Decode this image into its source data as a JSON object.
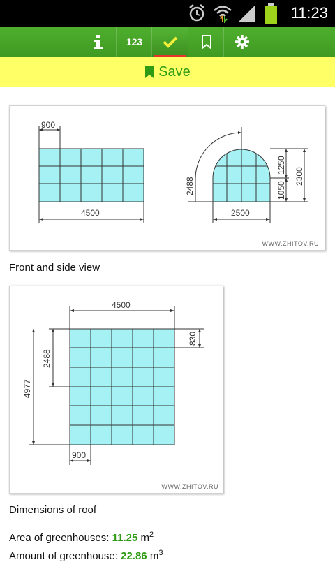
{
  "status_bar": {
    "time": "11:23",
    "icons": [
      "alarm-icon",
      "wifi-icon",
      "signal-icon",
      "battery-icon"
    ]
  },
  "toolbar": {
    "items": [
      {
        "name": "info",
        "icon": "info-icon"
      },
      {
        "name": "numbers",
        "label": "123"
      },
      {
        "name": "check",
        "icon": "check-icon",
        "active": true
      },
      {
        "name": "bookmark",
        "icon": "bookmark-icon"
      },
      {
        "name": "settings",
        "icon": "gear-icon"
      }
    ]
  },
  "save_bar": {
    "label": "Save",
    "icon": "bookmark-icon"
  },
  "diagram1": {
    "dim_900": "900",
    "dim_4500": "4500",
    "dim_2488": "2488",
    "dim_2500": "2500",
    "dim_1250": "1250",
    "dim_1050": "1050",
    "dim_2300": "2300",
    "watermark": "WWW.ZHITOV.RU",
    "caption": "Front and side view"
  },
  "diagram2": {
    "dim_4500": "4500",
    "dim_830": "830",
    "dim_2488": "2488",
    "dim_4977": "4977",
    "dim_900": "900",
    "watermark": "WWW.ZHITOV.RU",
    "caption": "Dimensions of roof"
  },
  "stats": {
    "area_label": "Area of greenhouses: ",
    "area_value": "11.25",
    "area_unit": "m",
    "area_exp": "2",
    "amount_label": "Amount of greenhouse: ",
    "amount_value": "22.86",
    "amount_unit": "m",
    "amount_exp": "3"
  },
  "colors": {
    "toolbar_green": "#3f9a22",
    "save_bar_yellow": "#ffff66",
    "accent_green": "#2f9b14",
    "pane_cyan": "#a6f1f4",
    "active_underline": "#e6322b"
  }
}
